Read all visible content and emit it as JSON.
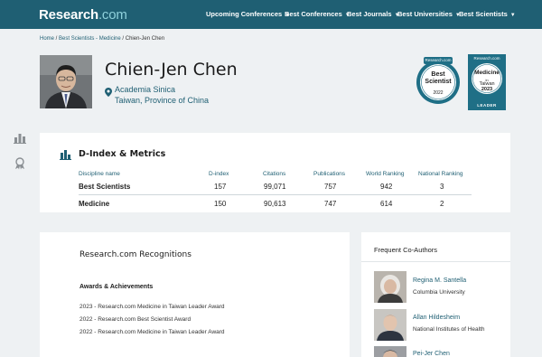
{
  "nav": {
    "logo_main": "Research",
    "logo_suffix": ".com",
    "items": [
      {
        "label": "Upcoming Conferences"
      },
      {
        "label": "Best Conferences"
      },
      {
        "label": "Best Journals"
      },
      {
        "label": "Best Universities"
      },
      {
        "label": "Best Scientists"
      }
    ]
  },
  "breadcrumb": {
    "home": "Home",
    "sep1": " / ",
    "section": "Best Scientists - Medicine",
    "sep2": " / ",
    "current": "Chien-Jen Chen"
  },
  "profile": {
    "name": "Chien-Jen Chen",
    "institution": "Academia Sinica",
    "location": "Taiwan, Province of China"
  },
  "badges": {
    "best_scientist": {
      "brand": "Research.com",
      "line1": "Best",
      "line2": "Scientist",
      "year": "2022"
    },
    "medicine": {
      "brand": "Research.com",
      "line1": "Medicine",
      "line2": "in",
      "line3": "Taiwan",
      "year": "2023",
      "ribbon": "LEADER"
    }
  },
  "metrics": {
    "title": "D-Index & Metrics",
    "headers": [
      "Discipline name",
      "D-index",
      "Citations",
      "Publications",
      "World Ranking",
      "National Ranking"
    ],
    "rows": [
      {
        "discipline": "Best Scientists",
        "d_index": "157",
        "citations": "99,071",
        "publications": "757",
        "world_ranking": "942",
        "national_ranking": "3"
      },
      {
        "discipline": "Medicine",
        "d_index": "150",
        "citations": "90,613",
        "publications": "747",
        "world_ranking": "614",
        "national_ranking": "2"
      }
    ]
  },
  "recognitions": {
    "title": "Research.com Recognitions",
    "awards_title": "Awards & Achievements",
    "awards": [
      "2023 - Research.com Medicine in Taiwan Leader Award",
      "2022 - Research.com Best Scientist Award",
      "2022 - Research.com Medicine in Taiwan Leader Award"
    ]
  },
  "coauthors": {
    "title": "Frequent Co-Authors",
    "items": [
      {
        "name": "Regina M. Santella",
        "affiliation": "Columbia University"
      },
      {
        "name": "Allan Hildesheim",
        "affiliation": "National Institutes of Health"
      },
      {
        "name": "Pei-Jer Chen",
        "affiliation": ""
      }
    ]
  },
  "colors": {
    "brand": "#1f5f73",
    "badge_teal": "#1f6f86",
    "background": "#eef1f3"
  },
  "icons": {
    "side": [
      "bar-chart-icon",
      "award-ribbon-icon"
    ],
    "location": "map-pin-icon"
  }
}
